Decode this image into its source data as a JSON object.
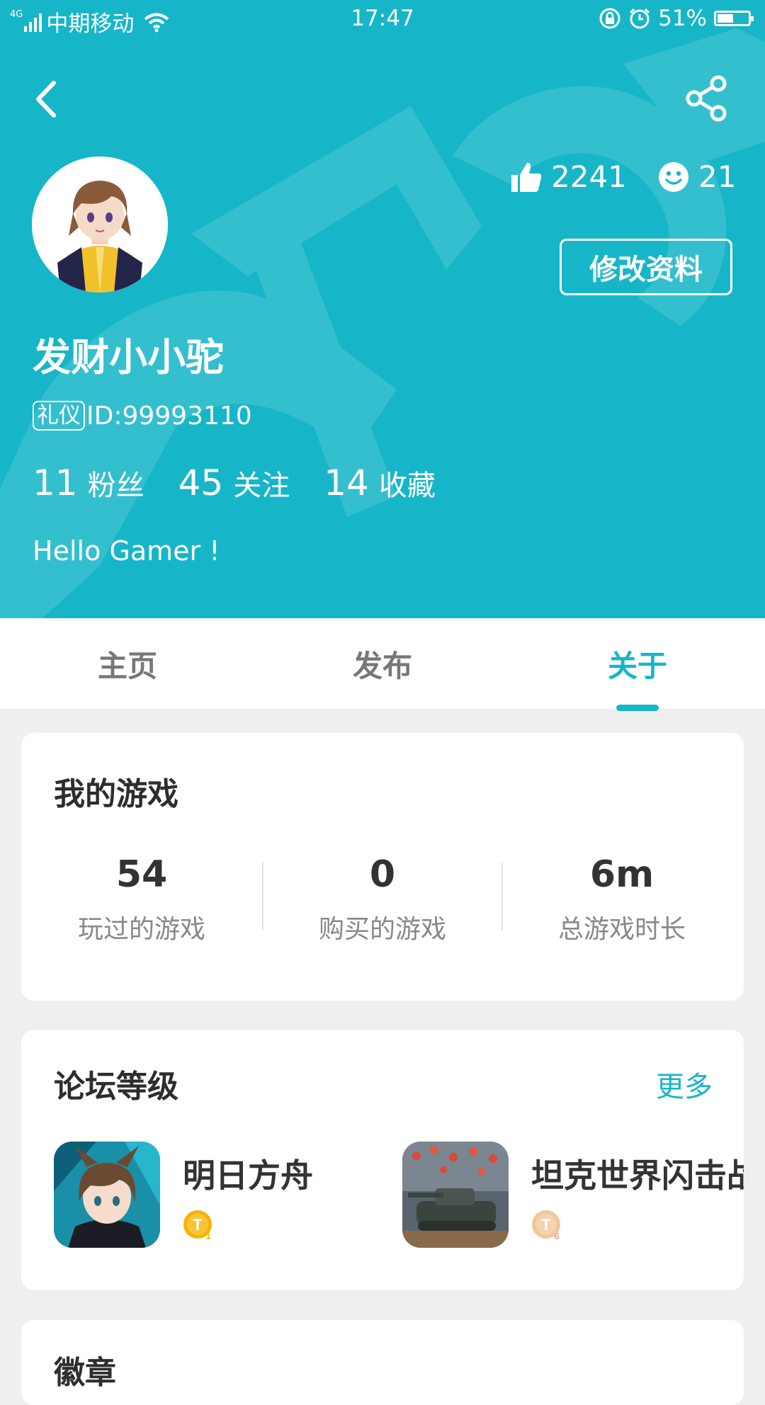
{
  "status_bar": {
    "network": "4G",
    "carrier": "中期移动",
    "time": "17:47",
    "battery": "51%"
  },
  "profile": {
    "likes": "2241",
    "smiles": "21",
    "edit_button": "修改资料",
    "username": "发财小小驼",
    "badge": "礼仪",
    "id_text": "ID:99993110",
    "counts": [
      {
        "num": "11",
        "label": "粉丝"
      },
      {
        "num": "45",
        "label": "关注"
      },
      {
        "num": "14",
        "label": "收藏"
      }
    ],
    "bio": "Hello Gamer !"
  },
  "tabs": [
    {
      "label": "主页",
      "active": false
    },
    {
      "label": "发布",
      "active": false
    },
    {
      "label": "关于",
      "active": true
    }
  ],
  "my_games": {
    "title": "我的游戏",
    "stats": [
      {
        "value": "54",
        "label": "玩过的游戏"
      },
      {
        "value": "0",
        "label": "购买的游戏"
      },
      {
        "value": "6m",
        "label": "总游戏时长"
      }
    ]
  },
  "forum_level": {
    "title": "论坛等级",
    "more": "更多",
    "items": [
      {
        "name": "明日方舟",
        "level": "1"
      },
      {
        "name": "坦克世界闪击战",
        "level": "6"
      }
    ]
  },
  "next_section": {
    "title": "徽章"
  },
  "colors": {
    "accent": "#16b6c8",
    "background": "#efefef",
    "badge_gold": "#f4b400"
  }
}
